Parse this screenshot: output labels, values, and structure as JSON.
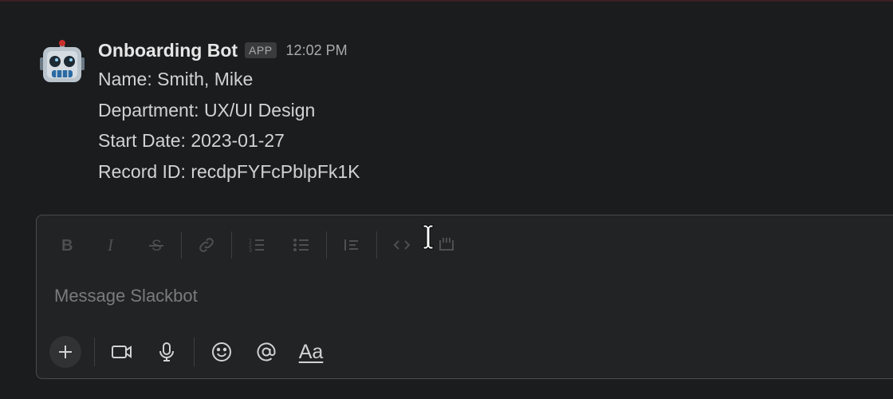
{
  "colors": {
    "background": "#1b1c1e",
    "composer_bg": "#222325",
    "composer_border": "#4a4b4d",
    "text": "#d1d2d3",
    "muted": "#a9aaab",
    "disabled_icon": "#4e4f51"
  },
  "message": {
    "avatar_icon": "robot-face-emoji",
    "sender": "Onboarding Bot",
    "badge": "APP",
    "timestamp": "12:02 PM",
    "lines": [
      "Name: Smith, Mike",
      "Department: UX/UI Design",
      "Start Date: 2023-01-27",
      "Record ID: recdpFYFcPblpFk1K"
    ]
  },
  "composer": {
    "placeholder": "Message Slackbot",
    "toolbar_icons": [
      "bold-icon",
      "italic-icon",
      "strikethrough-icon",
      "link-icon",
      "ordered-list-icon",
      "bulleted-list-icon",
      "blockquote-icon",
      "code-icon",
      "code-block-icon"
    ],
    "bottom_icons": [
      "plus-icon",
      "video-icon",
      "microphone-icon",
      "emoji-icon",
      "mention-icon",
      "formatting-icon"
    ],
    "format_label": "Aa"
  }
}
